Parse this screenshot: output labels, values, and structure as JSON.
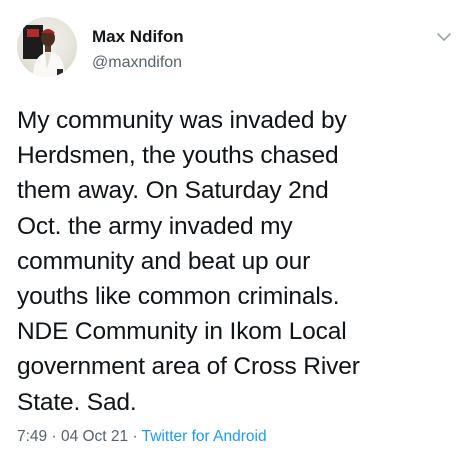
{
  "author": {
    "name": "Max Ndifon",
    "handle": "@maxndifon",
    "avatar_icon": "profile-photo"
  },
  "menu_icon": "chevron-down-icon",
  "tweet": {
    "lines": [
      "My community was invaded by",
      "Herdsmen, the youths chased",
      "them away. On Saturday 2nd",
      "Oct. the army invaded my",
      "community and beat up our",
      "youths like common criminals.",
      "NDE Community in Ikom Local",
      "government area of Cross River",
      "State. Sad."
    ]
  },
  "meta": {
    "time": "7:49",
    "separator": " · ",
    "date": "04 Oct 21",
    "source": "Twitter for Android"
  },
  "colors": {
    "text": "#0f1419",
    "secondary": "#536471",
    "link": "#1d9bf0"
  }
}
